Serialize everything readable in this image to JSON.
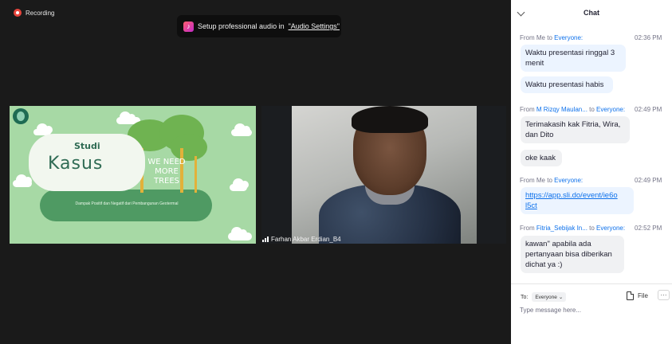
{
  "recording": {
    "label": "Recording"
  },
  "audio_banner": {
    "text": "Setup professional audio in ",
    "link": "\"Audio Settings\""
  },
  "share": {
    "studi": "Studi",
    "kasus": "Kasus",
    "need_trees_1": "WE NEED",
    "need_trees_2": "MORE",
    "need_trees_3": "TREES",
    "subtitle": "Dampak Positif dan Negatif dari Pembangunan Geotermal"
  },
  "video": {
    "participant_name": "Farhan Akbar Erdian_B4"
  },
  "chat": {
    "title": "Chat",
    "messages": [
      {
        "from_label": "From Me to ",
        "to": "Everyone:",
        "time": "02:36 PM",
        "bubbles": [
          "Waktu presentasi ringgal 3 menit",
          "Waktu presentasi habis"
        ]
      },
      {
        "from_label": "From ",
        "sender": "M Rizqy Maulan...",
        "to_label": " to ",
        "to": "Everyone:",
        "time": "02:49 PM",
        "bubbles": [
          "Terimakasih kak Fitria, Wira, dan Dito",
          "oke kaak"
        ]
      },
      {
        "from_label": "From Me to ",
        "to": "Everyone:",
        "time": "02:49 PM",
        "bubbles": [
          "https://app.sli.do/event/ie6o l5ct"
        ]
      },
      {
        "from_label": "From ",
        "sender": "Fitria_Sebijak In...",
        "to_label": " to ",
        "to": "Everyone:",
        "time": "02:52 PM",
        "bubbles": [
          "kawan\" apabila ada pertanyaan bisa diberikan dichat ya :)"
        ]
      }
    ],
    "to_label": "To:",
    "recipient": "Everyone",
    "file_label": "File",
    "more_label": "···",
    "input_placeholder": "Type message here..."
  }
}
